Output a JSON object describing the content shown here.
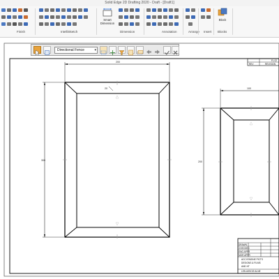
{
  "app": {
    "title": "Solid Edge 2D Drafting 2020 - Draft - [Draft1]"
  },
  "ribbon": {
    "groups": [
      {
        "label": "Finish"
      },
      {
        "label": "IntelliSketch"
      },
      {
        "label": "Dimension"
      },
      {
        "label": "Annotation"
      },
      {
        "label": "Arrange"
      },
      {
        "label": "Insert"
      },
      {
        "label": "Blocks"
      }
    ],
    "smart_dimension": {
      "label_line1": "Smart",
      "label_line2": "Dimension"
    },
    "block": {
      "label": "Block"
    }
  },
  "command_bar": {
    "selection_mode": "Directional Fence"
  },
  "drawing": {
    "left_view": {
      "width_dim": "200",
      "height_dim": "300",
      "chamfer_dim": "20"
    },
    "right_view": {
      "width_dim": "100",
      "height_dim": "200"
    },
    "title_block": {
      "top_right_label": "FL 02",
      "rev_labels": [
        "REV",
        "REVISION"
      ],
      "row_labels": [
        "DRAWN",
        "CHECKED",
        "ENG APPR",
        "MGR APPR"
      ],
      "company_lines": [
        "ACCI ENGINE PICTS",
        "DESIGNS & FILMS",
        "AND HT"
      ],
      "sheet_text": "LEN ASSCIE ALNE"
    }
  },
  "colors": {
    "ribbon_bg": "#f7f7f7",
    "accent_orange": "#e8a33d",
    "line_color": "#000000"
  }
}
